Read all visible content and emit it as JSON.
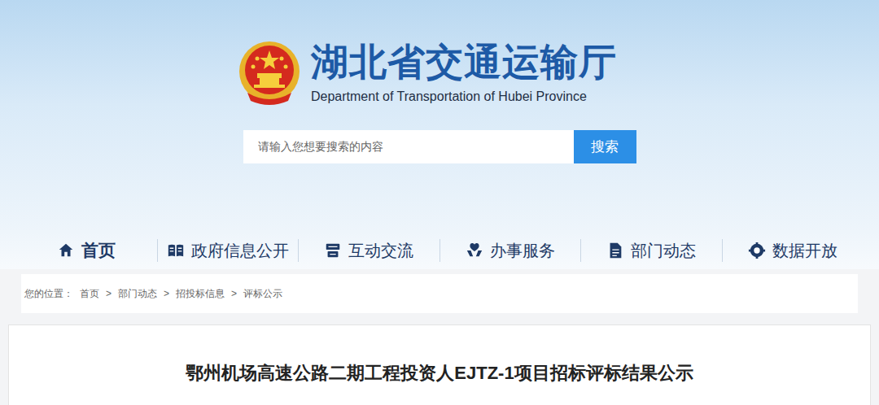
{
  "header": {
    "title": "湖北省交通运输厅",
    "subtitle": "Department of Transportation of Hubei Province"
  },
  "search": {
    "placeholder": "请输入您想要搜索的内容",
    "button": "搜索"
  },
  "nav": [
    {
      "label": "首页",
      "selected": true
    },
    {
      "label": "政府信息公开",
      "selected": false
    },
    {
      "label": "互动交流",
      "selected": false
    },
    {
      "label": "办事服务",
      "selected": false
    },
    {
      "label": "部门动态",
      "selected": false
    },
    {
      "label": "数据开放",
      "selected": false
    }
  ],
  "breadcrumb": {
    "label": "您的位置：",
    "separator": ">",
    "items": [
      "首页",
      "部门动态",
      "招投标信息",
      "评标公示"
    ]
  },
  "article": {
    "title": "鄂州机场高速公路二期工程投资人EJTZ-1项目招标评标结果公示"
  }
}
